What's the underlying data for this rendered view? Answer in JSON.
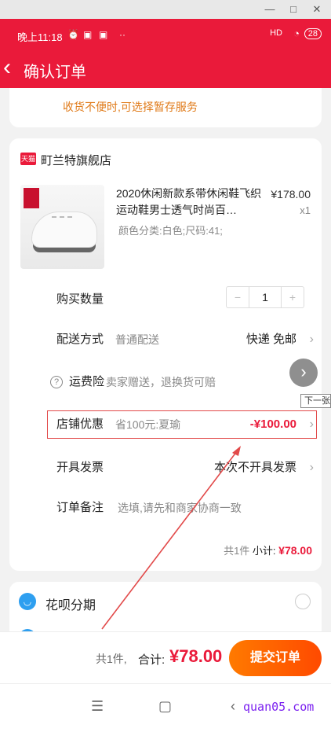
{
  "status_bar": {
    "time": "晚上11:18",
    "signal": "HD",
    "battery": "28"
  },
  "header": {
    "title": "确认订单"
  },
  "notice": {
    "text": "收货不便时,可选择暂存服务"
  },
  "store": {
    "badge": "天猫",
    "name": "町兰特旗舰店"
  },
  "product": {
    "title": "2020休闲新款系带休闲鞋飞织运动鞋男士透气时尚百…",
    "variant": "颜色分类:白色;尺码:41;",
    "price": "¥178.00",
    "qty": "x1"
  },
  "quantity": {
    "label": "购买数量",
    "value": "1",
    "minus": "−",
    "plus": "+"
  },
  "delivery": {
    "label": "配送方式",
    "sub": "普通配送",
    "value": "快递 免邮"
  },
  "insurance": {
    "label": "运费险",
    "sub": "卖家赠送，退换货可赔"
  },
  "store_discount": {
    "label": "店铺优惠",
    "sub": "省100元:夏瑜",
    "value": "-¥100.00"
  },
  "invoice": {
    "label": "开具发票",
    "value": "本次不开具发票"
  },
  "remark": {
    "label": "订单备注",
    "placeholder": "选填,请先和商家协商一致"
  },
  "subtotal": {
    "count": "共1件",
    "label": "小计:",
    "amount": "¥78.00"
  },
  "tooltip": {
    "text": "下一张"
  },
  "payment": {
    "huabei_label": "花呗分期"
  },
  "footer": {
    "count": "共1件,",
    "total_label": "合计:",
    "total_amount": "¥78.00",
    "submit": "提交订单"
  },
  "watermark": {
    "text": "quan05.com"
  },
  "colors": {
    "brand_red": "#ea1a3a",
    "submit_orange": "#ff5a00",
    "notice_orange": "#e07a18"
  }
}
